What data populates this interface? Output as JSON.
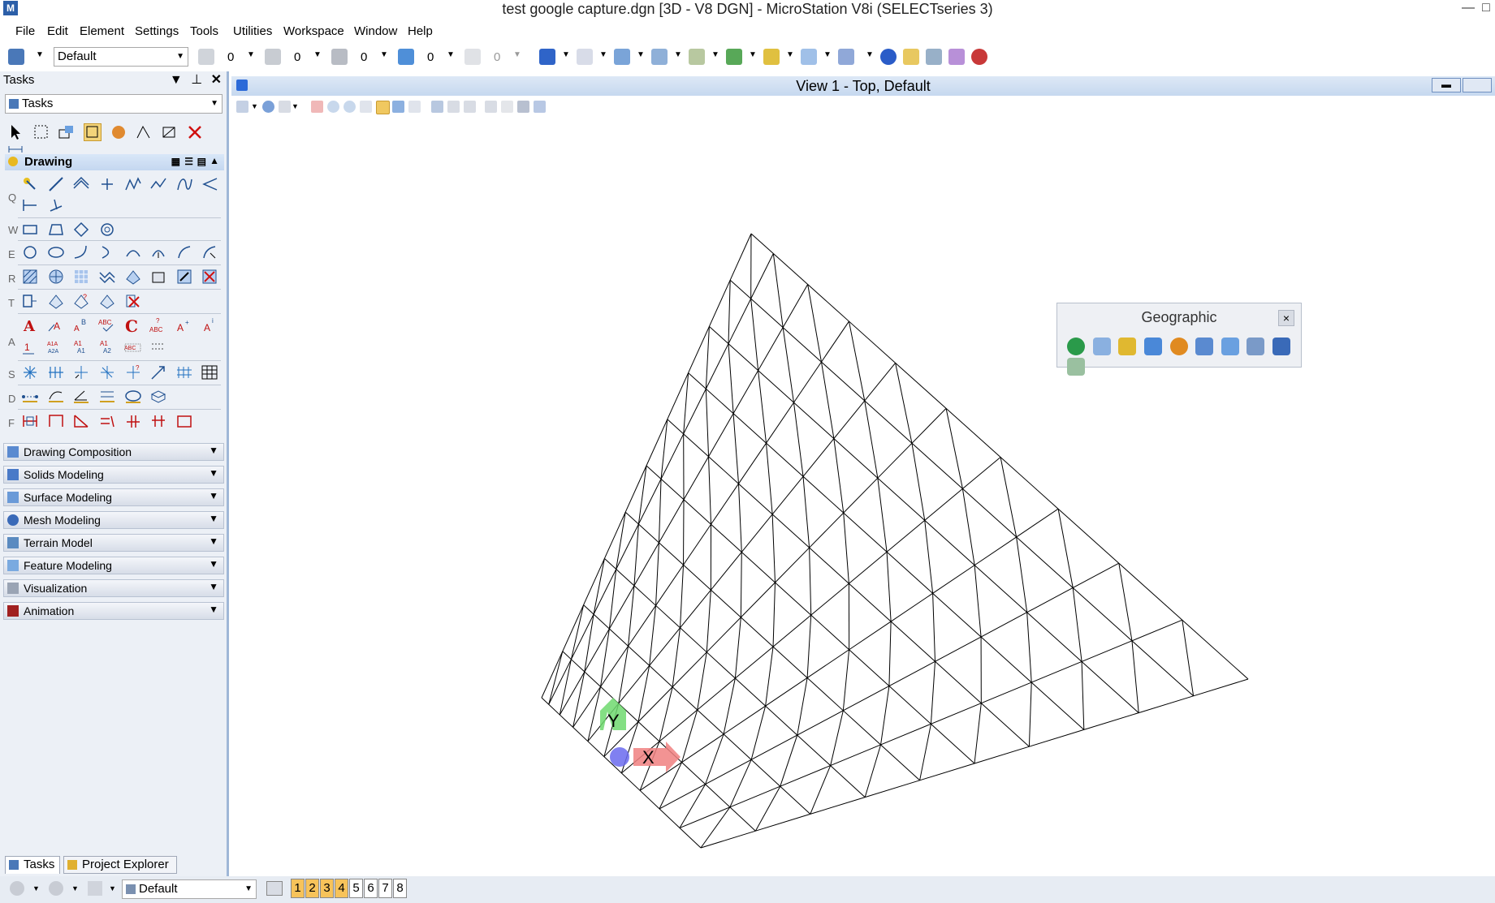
{
  "window": {
    "title": "test google capture.dgn [3D - V8 DGN] - MicroStation V8i (SELECTseries 3)",
    "minimize": "—",
    "restore": "□"
  },
  "menu": [
    "File",
    "Edit",
    "Element",
    "Settings",
    "Tools",
    "Utilities",
    "Workspace",
    "Window",
    "Help"
  ],
  "toolbar": {
    "level_value": "Default",
    "color_value": "0",
    "style_value": "0",
    "weight_value": "0",
    "transparency_value": "0",
    "priority_value": "0"
  },
  "tasks_panel": {
    "title": "Tasks",
    "selector": "Tasks",
    "drawing_label": "Drawing",
    "group_letters": [
      "Q",
      "W",
      "E",
      "R",
      "T",
      "A",
      "S",
      "D",
      "F"
    ],
    "sections": [
      "Drawing Composition",
      "Solids Modeling",
      "Surface Modeling",
      "Mesh Modeling",
      "Terrain Model",
      "Feature Modeling",
      "Visualization",
      "Animation"
    ],
    "tabs": [
      "Tasks",
      "Project Explorer"
    ]
  },
  "view": {
    "title": "View 1 - Top, Default"
  },
  "geographic": {
    "title": "Geographic",
    "close": "×"
  },
  "axis": {
    "x_label": "X",
    "y_label": "Y"
  },
  "statusbar": {
    "model": "Default",
    "views": [
      "1",
      "2",
      "3",
      "4",
      "5",
      "6",
      "7",
      "8"
    ],
    "active_views": [
      true,
      true,
      true,
      true,
      false,
      false,
      false,
      false
    ]
  },
  "colors": {
    "accent": "#2c5fa8",
    "x_axis": "#f08080",
    "y_axis": "#6fd96f",
    "z_axis": "#6a6aee",
    "active_view": "#f7c35a"
  }
}
